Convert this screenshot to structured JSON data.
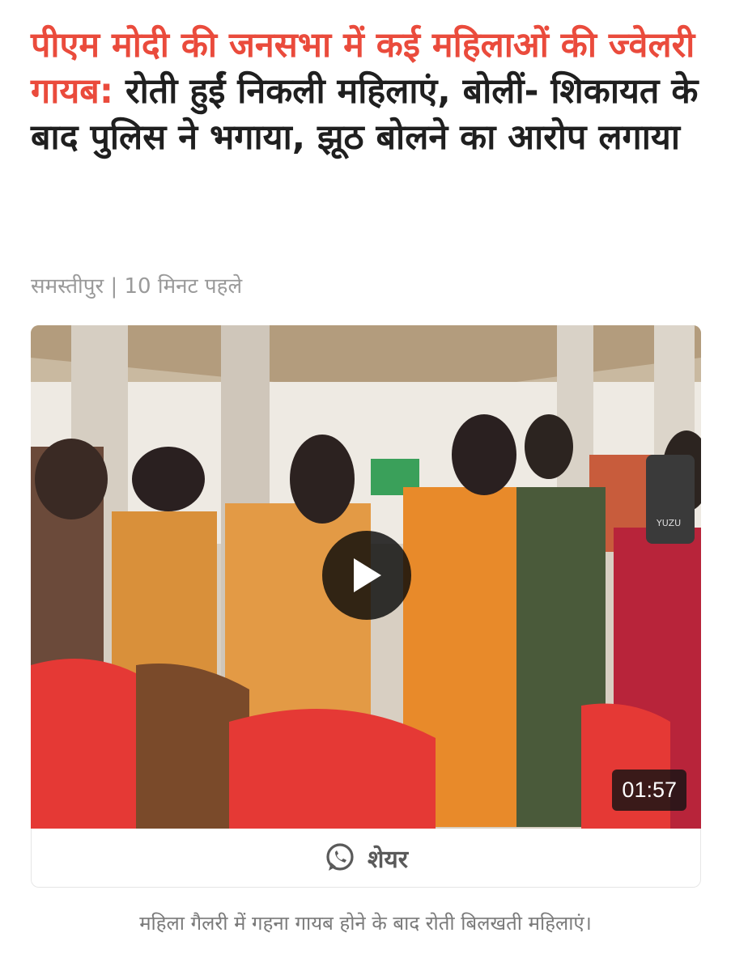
{
  "article": {
    "headline_highlight": "पीएम मोदी की जनसभा में कई महिलाओं की ज्वेलरी गायब:",
    "headline_rest": " रोती हुईं निकली महिलाएं, बोलीं- शिकायत के बाद पुलिस ने भगाया, झूठ बोलने का आरोप लगाया",
    "meta": "समस्तीपुर | 10 मिनट पहले"
  },
  "video": {
    "duration": "01:57",
    "chair_text": "YUZU"
  },
  "share": {
    "label": "शेयर",
    "icon": "whatsapp-icon"
  },
  "caption": "महिला गैलरी में गहना गायब होने के बाद रोती बिलखती महिलाएं।",
  "colors": {
    "headline_accent": "#ea4b3c",
    "headline_text": "#1f1f1f",
    "meta_text": "#9a9a9a"
  }
}
